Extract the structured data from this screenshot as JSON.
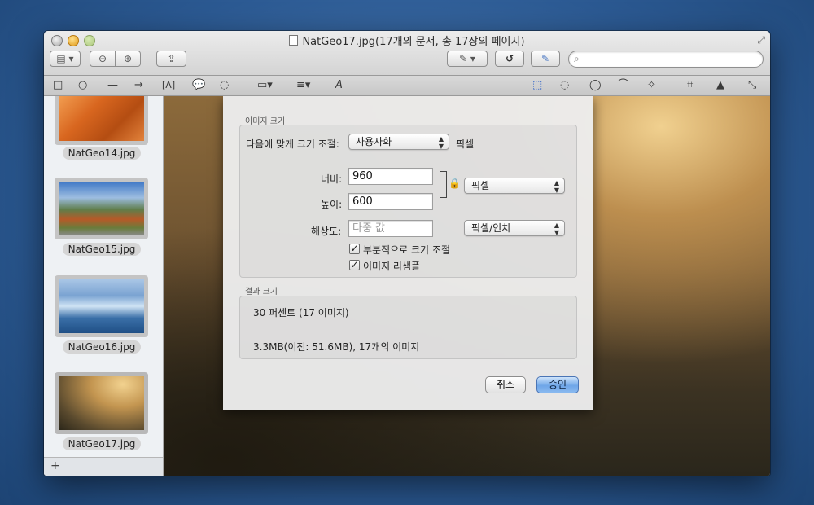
{
  "window": {
    "title": "NatGeo17.jpg(17개의 문서, 총 17장의 페이지)"
  },
  "toolbar": {
    "view_icon": "sidebar-view-icon",
    "zoom_out_icon": "zoom-out-icon",
    "zoom_in_icon": "zoom-in-icon",
    "share_icon": "share-icon",
    "annotate_icon": "pen-icon",
    "rotate_icon": "rotate-icon",
    "markup_icon": "markup-toolbar-icon",
    "search_placeholder": ""
  },
  "markup_tools": [
    "rectangle-icon",
    "oval-icon",
    "line-icon",
    "arrow-icon",
    "text-box-icon",
    "speech-bubble-icon",
    "thought-bubble-icon",
    "color-icon",
    "line-weight-icon",
    "font-icon",
    "rect-select-icon",
    "ellipse-select-icon",
    "lasso-icon",
    "smart-lasso-icon",
    "instant-alpha-icon",
    "crop-icon",
    "adjust-color-icon",
    "adjust-size-icon"
  ],
  "sidebar": {
    "thumbnails": [
      {
        "label": "NatGeo14.jpg"
      },
      {
        "label": "NatGeo15.jpg"
      },
      {
        "label": "NatGeo16.jpg"
      },
      {
        "label": "NatGeo17.jpg"
      }
    ],
    "add_label": "+"
  },
  "dialog": {
    "image_size_label": "이미지 크기",
    "fit_label": "다음에 맞게 크기 조절:",
    "fit_value": "사용자화",
    "fit_unit": "픽셀",
    "width_label": "너비:",
    "width_value": "960",
    "height_label": "높이:",
    "height_value": "600",
    "size_unit": "픽셀",
    "resolution_label": "해상도:",
    "resolution_placeholder": "다중 값",
    "resolution_unit": "픽셀/인치",
    "scale_label": "부분적으로 크기 조절",
    "scale_checked": true,
    "resample_label": "이미지 리샘플",
    "resample_checked": true,
    "result_label": "결과 크기",
    "result_percent": "30 퍼센트 (17 이미지)",
    "result_size": "3.3MB(이전: 51.6MB), 17개의 이미지",
    "cancel_label": "취소",
    "ok_label": "승인"
  }
}
